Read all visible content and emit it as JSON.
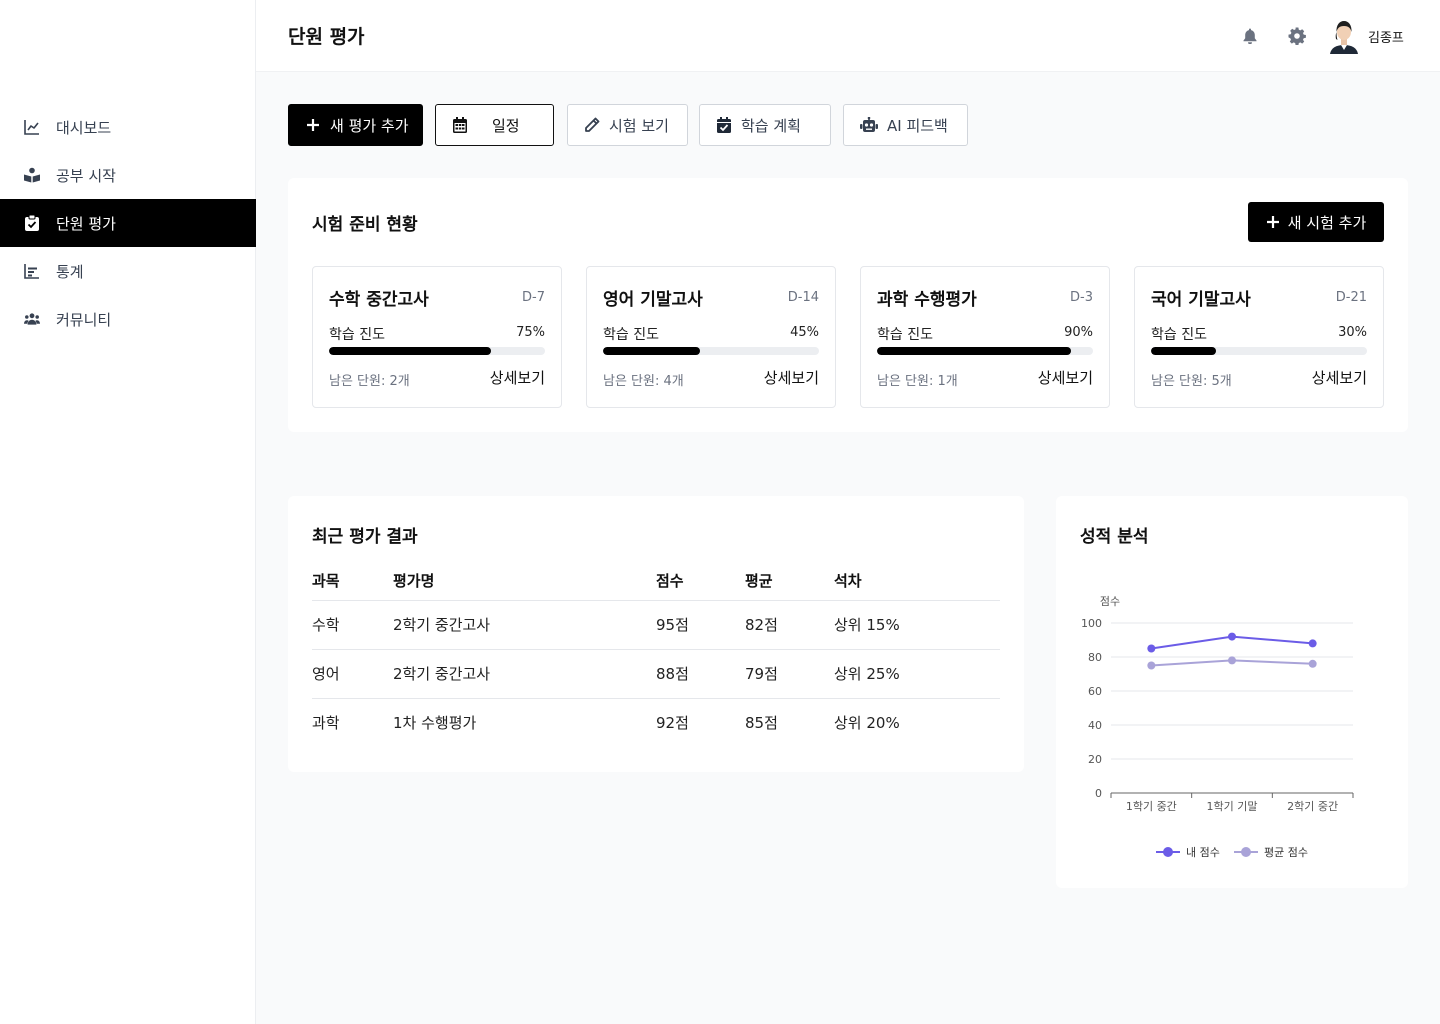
{
  "header": {
    "page_title": "단원 평가",
    "user_name": "김종프",
    "icons": [
      "bell-icon",
      "gear-icon"
    ]
  },
  "sidebar": {
    "items": [
      {
        "label": "대시보드",
        "icon": "chart-line-icon",
        "active": false
      },
      {
        "label": "공부 시작",
        "icon": "book-reader-icon",
        "active": false
      },
      {
        "label": "단원 평가",
        "icon": "clipboard-check-icon",
        "active": true
      },
      {
        "label": "통계",
        "icon": "bar-chart-icon",
        "active": false
      },
      {
        "label": "커뮤니티",
        "icon": "users-icon",
        "active": false
      }
    ]
  },
  "toolbar": {
    "add_eval": "새 평가 추가",
    "schedule": "일정",
    "view_exam": "시험 보기",
    "study_plan": "학습 계획",
    "ai_feedback": "AI 피드백"
  },
  "exam_prep": {
    "title": "시험 준비 현황",
    "add_button": "새 시험 추가",
    "cards": [
      {
        "name": "수학 중간고사",
        "dday": "D-7",
        "progress_label": "학습 진도",
        "progress_text": "75%",
        "progress": 75,
        "remaining": "남은 단원: 2개",
        "detail": "상세보기"
      },
      {
        "name": "영어 기말고사",
        "dday": "D-14",
        "progress_label": "학습 진도",
        "progress_text": "45%",
        "progress": 45,
        "remaining": "남은 단원: 4개",
        "detail": "상세보기"
      },
      {
        "name": "과학 수행평가",
        "dday": "D-3",
        "progress_label": "학습 진도",
        "progress_text": "90%",
        "progress": 90,
        "remaining": "남은 단원: 1개",
        "detail": "상세보기"
      },
      {
        "name": "국어 기말고사",
        "dday": "D-21",
        "progress_label": "학습 진도",
        "progress_text": "30%",
        "progress": 30,
        "remaining": "남은 단원: 5개",
        "detail": "상세보기"
      }
    ]
  },
  "recent_results": {
    "title": "최근 평가 결과",
    "columns": [
      "과목",
      "평가명",
      "점수",
      "평균",
      "석차"
    ],
    "rows": [
      [
        "수학",
        "2학기 중간고사",
        "95점",
        "82점",
        "상위 15%"
      ],
      [
        "영어",
        "2학기 중간고사",
        "88점",
        "79점",
        "상위 25%"
      ],
      [
        "과학",
        "1차 수행평가",
        "92점",
        "85점",
        "상위 20%"
      ]
    ]
  },
  "analysis": {
    "title": "성적 분석"
  },
  "chart_data": {
    "type": "line",
    "title": "",
    "ylabel": "점수",
    "xlabel": "",
    "categories": [
      "1학기 중간",
      "1학기 기말",
      "2학기 중간"
    ],
    "ylim": [
      0,
      100
    ],
    "yticks": [
      0,
      20,
      40,
      60,
      80,
      100
    ],
    "grid": true,
    "legend_position": "bottom",
    "series": [
      {
        "name": "내 점수",
        "values": [
          85,
          92,
          88
        ],
        "color": "#6b5ce7"
      },
      {
        "name": "평균 점수",
        "values": [
          75,
          78,
          76
        ],
        "color": "#a9a3d8"
      }
    ]
  }
}
